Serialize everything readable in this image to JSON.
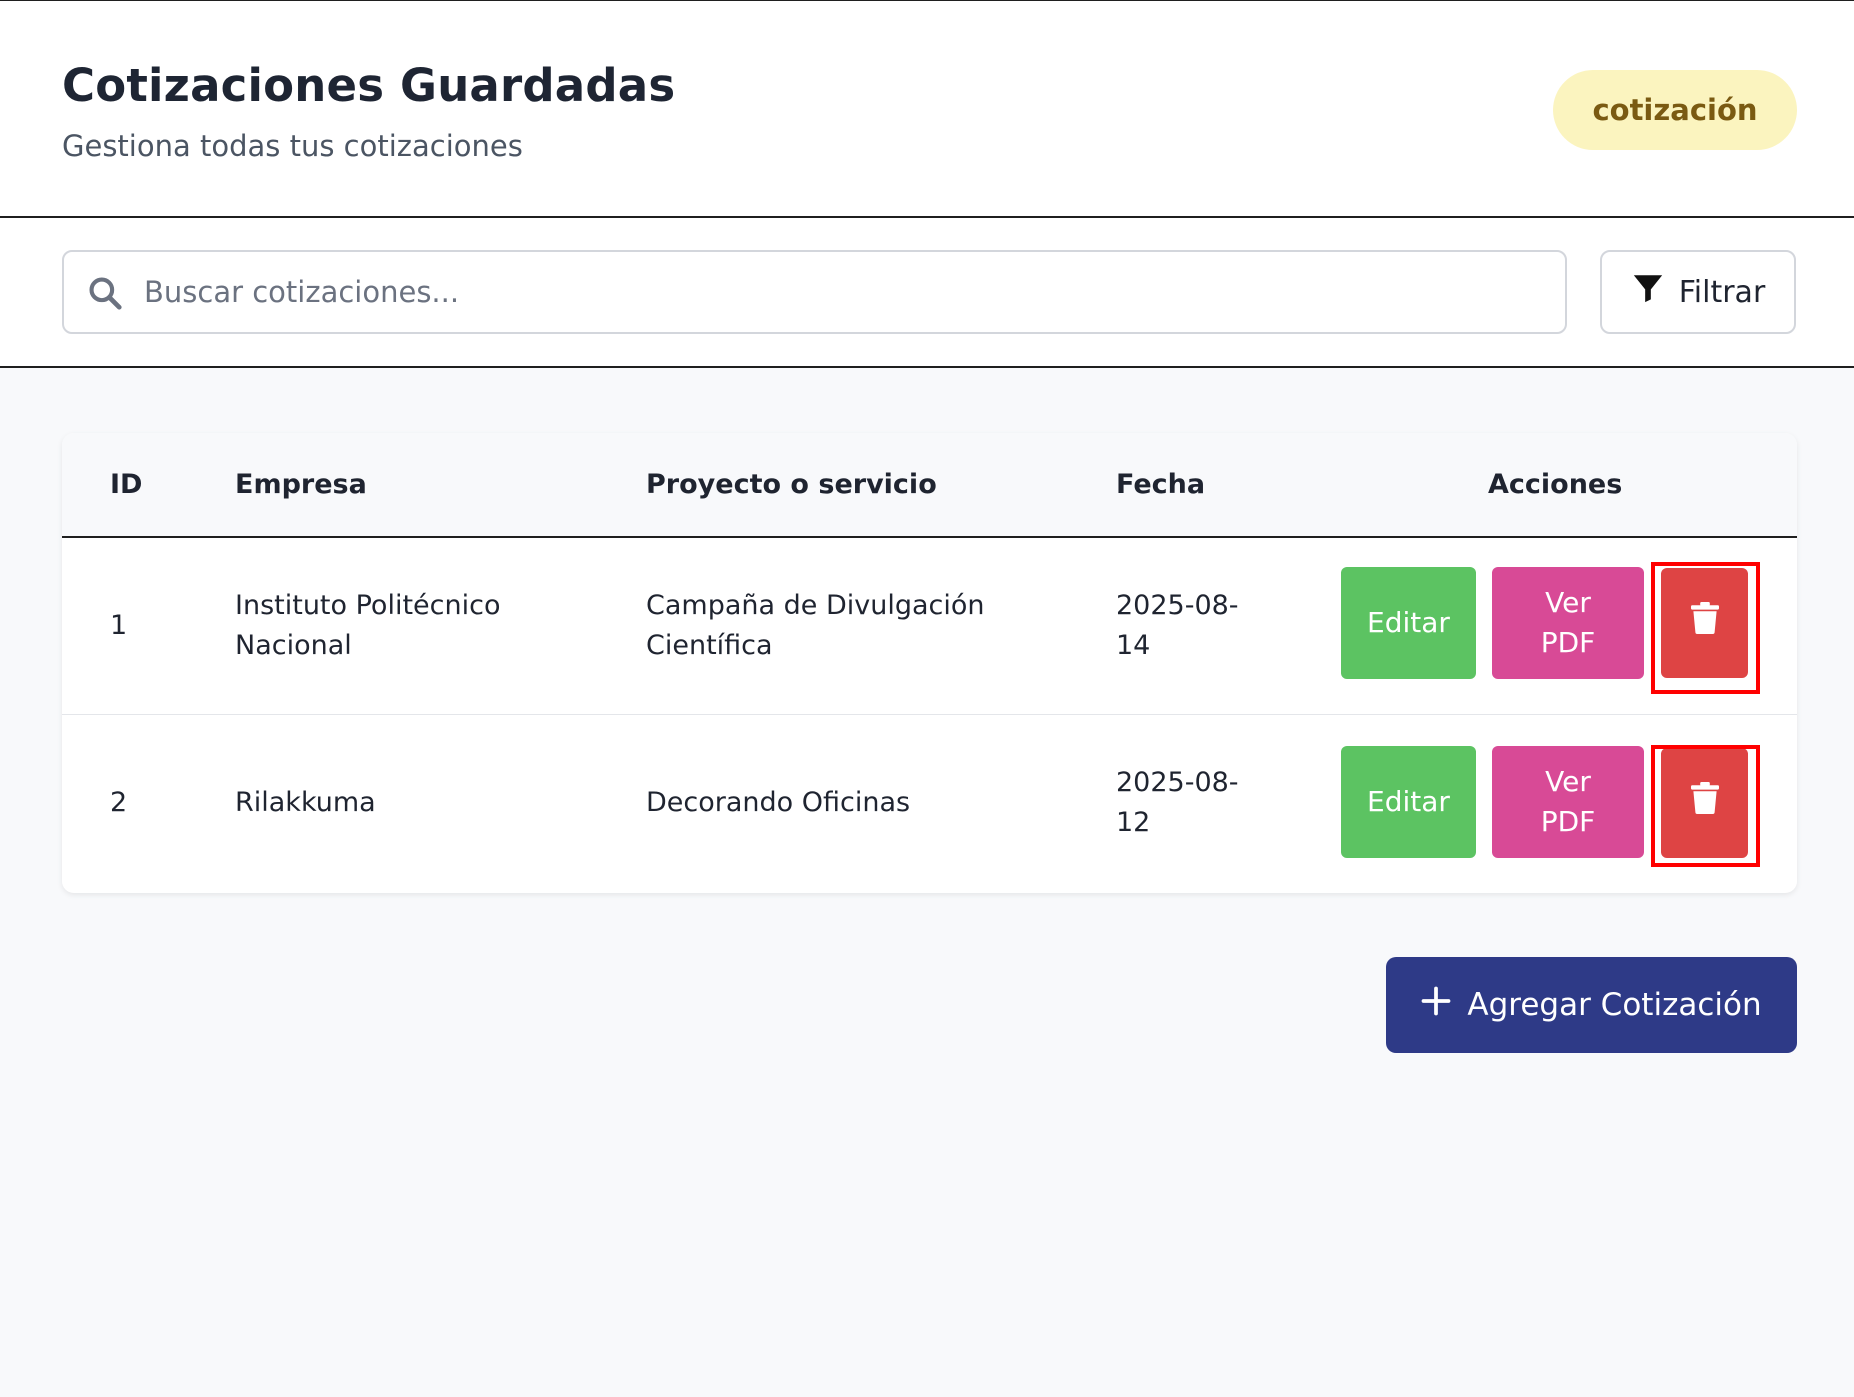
{
  "header": {
    "title": "Cotizaciones Guardadas",
    "subtitle": "Gestiona todas tus cotizaciones",
    "badge": "cotización"
  },
  "search": {
    "placeholder": "Buscar cotizaciones...",
    "value": "",
    "icon": "search-icon"
  },
  "filter": {
    "label": "Filtrar",
    "icon": "filter-icon"
  },
  "table": {
    "headers": [
      "ID",
      "Empresa",
      "Proyecto o servicio",
      "Fecha",
      "Acciones"
    ],
    "rows": [
      {
        "id": "1",
        "empresa_l1": "Instituto Politécnico",
        "empresa_l2": "Nacional",
        "proyecto_l1": "Campaña de Divulgación",
        "proyecto_l2": "Científica",
        "fecha_l1": "2025-08-",
        "fecha_l2": "14",
        "edit_label": "Editar",
        "pdf_l1": "Ver",
        "pdf_l2": "PDF",
        "delete_icon": "trash-icon"
      },
      {
        "id": "2",
        "empresa_l1": "Rilakkuma",
        "empresa_l2": "",
        "proyecto_l1": "Decorando Oficinas",
        "proyecto_l2": "",
        "fecha_l1": "2025-08-",
        "fecha_l2": "12",
        "edit_label": "Editar",
        "pdf_l1": "Ver",
        "pdf_l2": "PDF",
        "delete_icon": "trash-icon"
      }
    ]
  },
  "add_button": {
    "label": "Agregar Cotización",
    "icon": "plus-icon"
  },
  "colors": {
    "edit": "#5cc362",
    "pdf": "#d84a96",
    "delete": "#de4444",
    "primary": "#2e3a87",
    "badge_bg": "#fbf4bf",
    "badge_text": "#7a5a12",
    "highlight": "#ff0000"
  }
}
